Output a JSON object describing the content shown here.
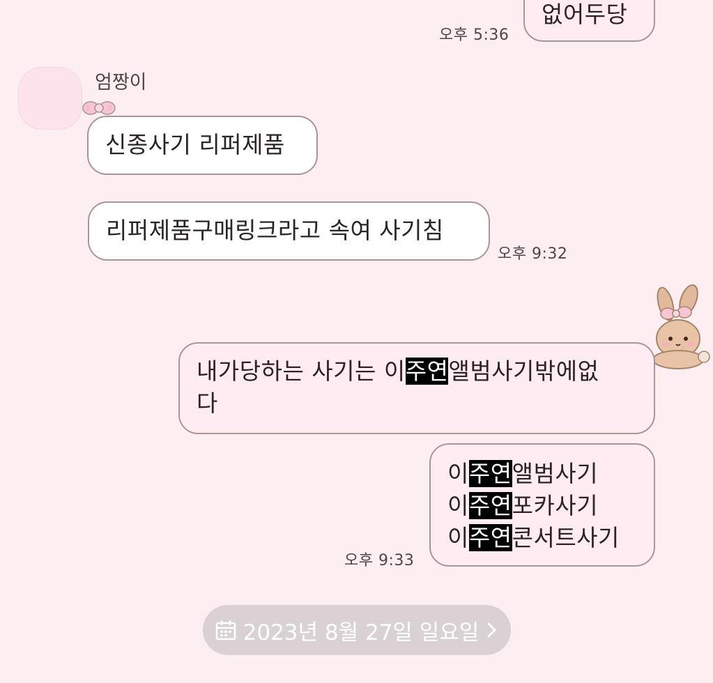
{
  "messages": [
    {
      "text": "없어두당",
      "time": "오후 5:36"
    },
    {
      "sender": "엄짱이",
      "text": "신종사기 리퍼제품"
    },
    {
      "text": "리퍼제품구매링크라고 속여 사기침",
      "time": "오후 9:32"
    },
    {
      "line1_a": "내가당하는 사기는 이",
      "line1_hl": "주연",
      "line1_b": "앨범사기밖에없",
      "line2": "다"
    },
    {
      "lines": [
        {
          "a": "이",
          "hl": "주연",
          "b": "앨범사기"
        },
        {
          "a": "이",
          "hl": "주연",
          "b": "포카사기"
        },
        {
          "a": "이",
          "hl": "주연",
          "b": "콘서트사기"
        }
      ],
      "time": "오후 9:33"
    }
  ],
  "date_separator": {
    "label": "2023년 8월 27일 일요일",
    "icon": "calendar-icon",
    "chevron": "chevron-right-icon"
  },
  "colors": {
    "background": "#fdeef2",
    "bubble_border": "#a89595",
    "incoming_bubble": "#ffffff",
    "outgoing_bubble": "#ffecf2",
    "date_pill": "#d9d1d4"
  }
}
